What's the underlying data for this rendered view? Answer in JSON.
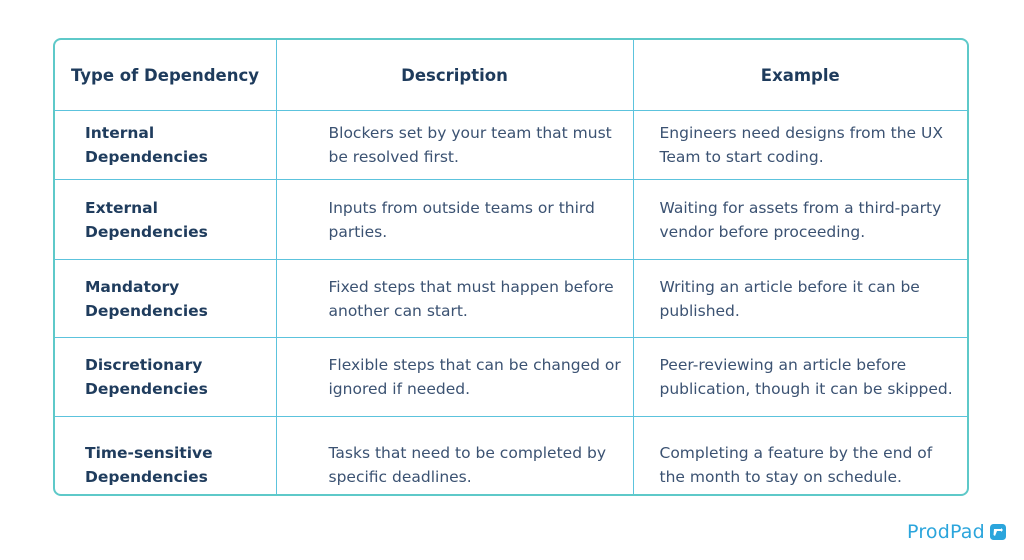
{
  "table": {
    "headers": [
      "Type of Dependency",
      "Description",
      "Example"
    ],
    "rows": [
      {
        "type": "Internal Dependencies",
        "type_lines": [
          "Internal",
          "Dependencies"
        ],
        "description": "Blockers set by your team that must be resolved first.",
        "example": "Engineers need designs from the UX Team to start coding."
      },
      {
        "type": "External Dependencies",
        "type_lines": [
          "External",
          "Dependencies"
        ],
        "description": "Inputs from outside teams or third parties.",
        "example": "Waiting for assets from a third-party vendor before proceeding."
      },
      {
        "type": "Mandatory Dependencies",
        "type_lines": [
          "Mandatory",
          "Dependencies"
        ],
        "description": "Fixed steps that must happen before another can start.",
        "example": "Writing an article before it can be published."
      },
      {
        "type": "Discretionary Dependencies",
        "type_lines": [
          "Discretionary",
          "Dependencies"
        ],
        "description": "Flexible steps that can be changed or ignored if needed.",
        "example": "Peer-reviewing an article before publication, though it can be skipped."
      },
      {
        "type": "Time-sensitive Dependencies",
        "type_lines": [
          "Time-sensitive",
          "Dependencies"
        ],
        "description": "Tasks that need to be completed by specific deadlines.",
        "example": "Completing a feature by the end of the month to stay on schedule."
      }
    ]
  },
  "brand": {
    "name": "ProdPad",
    "icon": "prodpad-logo-icon",
    "color": "#2ba5dc"
  },
  "colors": {
    "border": "#5ec9c9",
    "grid": "#5cc3dd",
    "header_text": "#1e3b5c",
    "body_text": "#3b5272"
  }
}
